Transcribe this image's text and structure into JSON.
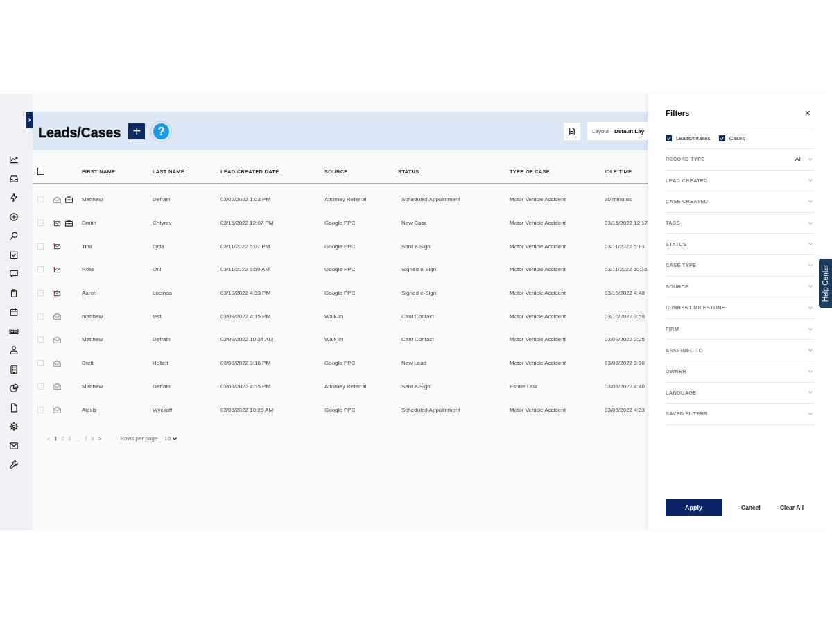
{
  "header": {
    "title": "Leads/Cases",
    "add_button": "+",
    "help_button": "?",
    "layout": {
      "label": "Layout",
      "value": "Default Lay"
    }
  },
  "table": {
    "select_all": {
      "checked": false
    },
    "columns": [
      "FIRST NAME",
      "LAST NAME",
      "LEAD CREATED DATE",
      "SOURCE",
      "STATUS",
      "TYPE OF CASE",
      "IDLE TIME"
    ],
    "rows": [
      {
        "checked": false,
        "unread": false,
        "has_case": true,
        "cells": [
          "Matthew",
          "Defrain",
          "03/02/2022 1:03 PM",
          "Attorney Referral",
          "Scheduled Appointment",
          "Motor Vehicle Accident",
          "30 minutes"
        ]
      },
      {
        "checked": false,
        "unread": true,
        "has_case": true,
        "cells": [
          "Dmitri",
          "Chtyrev",
          "03/15/2022 12:07 PM",
          "Google PPC",
          "New Case",
          "Motor Vehicle Accident",
          "03/15/2022 12:17"
        ]
      },
      {
        "checked": false,
        "unread": true,
        "has_case": false,
        "cells": [
          "Tina",
          "Lyda",
          "03/11/2022 5:07 PM",
          "Google PPC",
          "Sent e-Sign",
          "Motor Vehicle Accident",
          "03/11/2022 5:13"
        ]
      },
      {
        "checked": false,
        "unread": true,
        "has_case": false,
        "cells": [
          "Rolle",
          "Ohl",
          "03/11/2022 9:59 AM",
          "Google PPC",
          "Signed e-Sign",
          "Motor Vehicle Accident",
          "03/11/2022 10:16"
        ]
      },
      {
        "checked": false,
        "unread": true,
        "has_case": false,
        "cells": [
          "Aaron",
          "Lucinda",
          "03/10/2022 4:33 PM",
          "Google PPC",
          "Signed e-Sign",
          "Motor Vehicle Accident",
          "03/10/2022 4:48"
        ]
      },
      {
        "checked": false,
        "unread": false,
        "has_case": false,
        "cells": [
          "matthew",
          "test",
          "03/09/2022 4:15 PM",
          "Walk-in",
          "Cant Contact",
          "Motor Vehicle Accident",
          "03/10/2022 3:59"
        ]
      },
      {
        "checked": false,
        "unread": false,
        "has_case": false,
        "cells": [
          "Matthew",
          "Defrain",
          "03/09/2022 10:34 AM",
          "Walk-in",
          "Cant Contact",
          "Motor Vehicle Accident",
          "03/09/2022 3:25"
        ]
      },
      {
        "checked": false,
        "unread": false,
        "has_case": false,
        "cells": [
          "Brett",
          "Hollett",
          "03/08/2022 3:16 PM",
          "Google PPC",
          "New Lead",
          "Motor Vehicle Accident",
          "03/08/2022 3:30"
        ]
      },
      {
        "checked": false,
        "unread": false,
        "has_case": false,
        "cells": [
          "Matthew",
          "Defrain",
          "03/03/2022 4:35 PM",
          "Attorney Referral",
          "Sent e-Sign",
          "Estate Law",
          "03/03/2022 4:40"
        ]
      },
      {
        "checked": false,
        "unread": false,
        "has_case": false,
        "cells": [
          "Alexis",
          "Wyckoff",
          "03/03/2022 10:28 AM",
          "Google PPC",
          "Scheduled Appointment",
          "Motor Vehicle Accident",
          "03/03/2022 4:33"
        ]
      }
    ]
  },
  "pagination": {
    "prev": "<",
    "pages": [
      {
        "kind": "page",
        "label": "1",
        "selected": true
      },
      {
        "kind": "page",
        "label": "2",
        "selected": false
      },
      {
        "kind": "page",
        "label": "3",
        "selected": false
      },
      {
        "kind": "ellipsis",
        "label": "...",
        "selected": false
      },
      {
        "kind": "page",
        "label": "7",
        "selected": false
      },
      {
        "kind": "page",
        "label": "8",
        "selected": false
      }
    ],
    "next": ">",
    "rows_per_page": {
      "label": "Rows per page",
      "value": "10"
    }
  },
  "filters": {
    "title": "Filters",
    "close": "×",
    "record_types": [
      {
        "label": "Leads/Intakes",
        "checked": true
      },
      {
        "label": "Cases",
        "checked": true
      }
    ],
    "items": [
      {
        "label": "RECORD TYPE",
        "value": "All",
        "expanded": false
      },
      {
        "label": "LEAD CREATED",
        "expanded": false
      },
      {
        "label": "CASE CREATED",
        "expanded": false
      },
      {
        "label": "TAGS",
        "expanded": false
      },
      {
        "label": "STATUS",
        "expanded": false
      },
      {
        "label": "CASE TYPE",
        "expanded": false
      },
      {
        "label": "SOURCE",
        "expanded": false
      },
      {
        "label": "CURRENT MILESTONE",
        "expanded": false
      },
      {
        "label": "FIRM",
        "expanded": false
      },
      {
        "label": "ASSIGNED TO",
        "expanded": false
      },
      {
        "label": "OWNER",
        "expanded": false
      },
      {
        "label": "LANGUAGE",
        "expanded": false
      },
      {
        "label": "SAVED FILTERS",
        "expanded": false
      }
    ],
    "buttons": [
      {
        "kind": "primary",
        "label": "Apply"
      },
      {
        "kind": "text",
        "label": "Cancel"
      },
      {
        "kind": "text",
        "label": "Clear All"
      }
    ]
  },
  "help_tab": {
    "label": "Help Center"
  }
}
